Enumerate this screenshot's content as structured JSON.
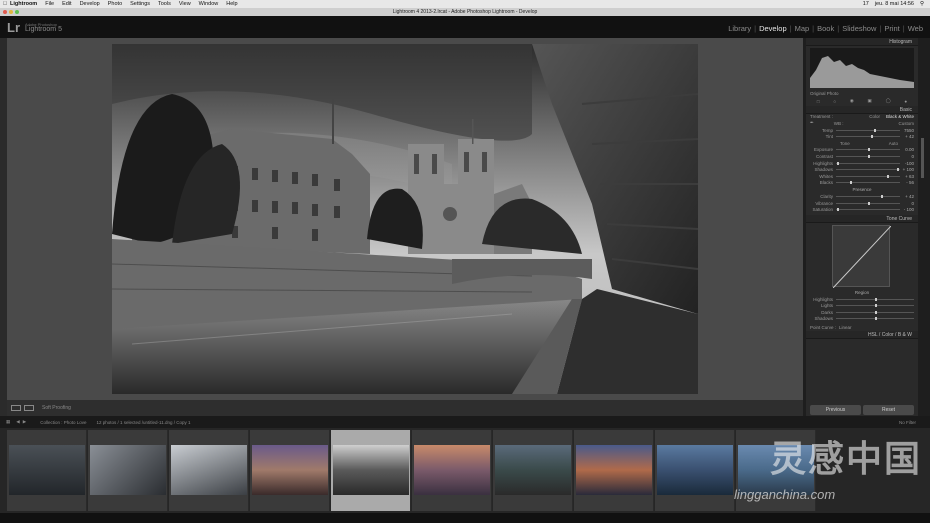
{
  "menubar": {
    "app": "Lightroom",
    "items": [
      "File",
      "Edit",
      "Develop",
      "Photo",
      "Settings",
      "Tools",
      "View",
      "Window",
      "Help"
    ],
    "clock": "jeu. 8 mai 14:56",
    "badge": "17"
  },
  "window": {
    "title": "Lightroom 4 2013-2.lrcat - Adobe Photoshop Lightroom - Develop"
  },
  "identity": {
    "logo": "Lr",
    "small": "Adobe Photoshop",
    "name": "Lightroom 5"
  },
  "modules": {
    "library": "Library",
    "develop": "Develop",
    "map": "Map",
    "book": "Book",
    "slideshow": "Slideshow",
    "print": "Print",
    "web": "Web"
  },
  "right": {
    "histogram": "Histogram",
    "original_photo": "Original Photo",
    "basic": "Basic",
    "treatment": "Treatment :",
    "color": "Color",
    "bw": "Black & White",
    "wb": "WB :",
    "wb_value": "Custom",
    "temp": "Temp",
    "temp_val": "7550",
    "tint": "Tint",
    "tint_val": "+ 42",
    "tone": "Tone",
    "auto": "Auto",
    "exposure": "Exposure",
    "exposure_val": "0.00",
    "contrast": "Contrast",
    "contrast_val": "0",
    "highlights": "Highlights",
    "highlights_val": "-100",
    "shadows": "Shadows",
    "shadows_val": "+ 100",
    "whites": "Whites",
    "whites_val": "+ 63",
    "blacks": "Blacks",
    "blacks_val": "- 56",
    "presence": "Presence",
    "clarity": "Clarity",
    "clarity_val": "+ 42",
    "vibrance": "Vibrance",
    "vibrance_val": "0",
    "saturation": "Saturation",
    "saturation_val": "- 100",
    "tonecurve": "Tone Curve",
    "region": "Region",
    "c_highlights": "Highlights",
    "c_lights": "Lights",
    "c_darks": "Darks",
    "c_shadows": "Shadows",
    "point_curve": "Point Curve :",
    "point_val": "Linear",
    "hsl": "HSL",
    "hsl_color": "Color",
    "hsl_bw": "B & W",
    "previous": "Previous",
    "reset": "Reset"
  },
  "toolbar": {
    "softproof": "Soft Proofing"
  },
  "filmstrip": {
    "source": "Collection : Photo Love",
    "path": "12 photos / 1 selected /untitled-11.dng / Copy 1",
    "filter": "No Filter"
  },
  "watermark": {
    "cn": "灵感中国",
    "url": "lingganchina.com"
  }
}
